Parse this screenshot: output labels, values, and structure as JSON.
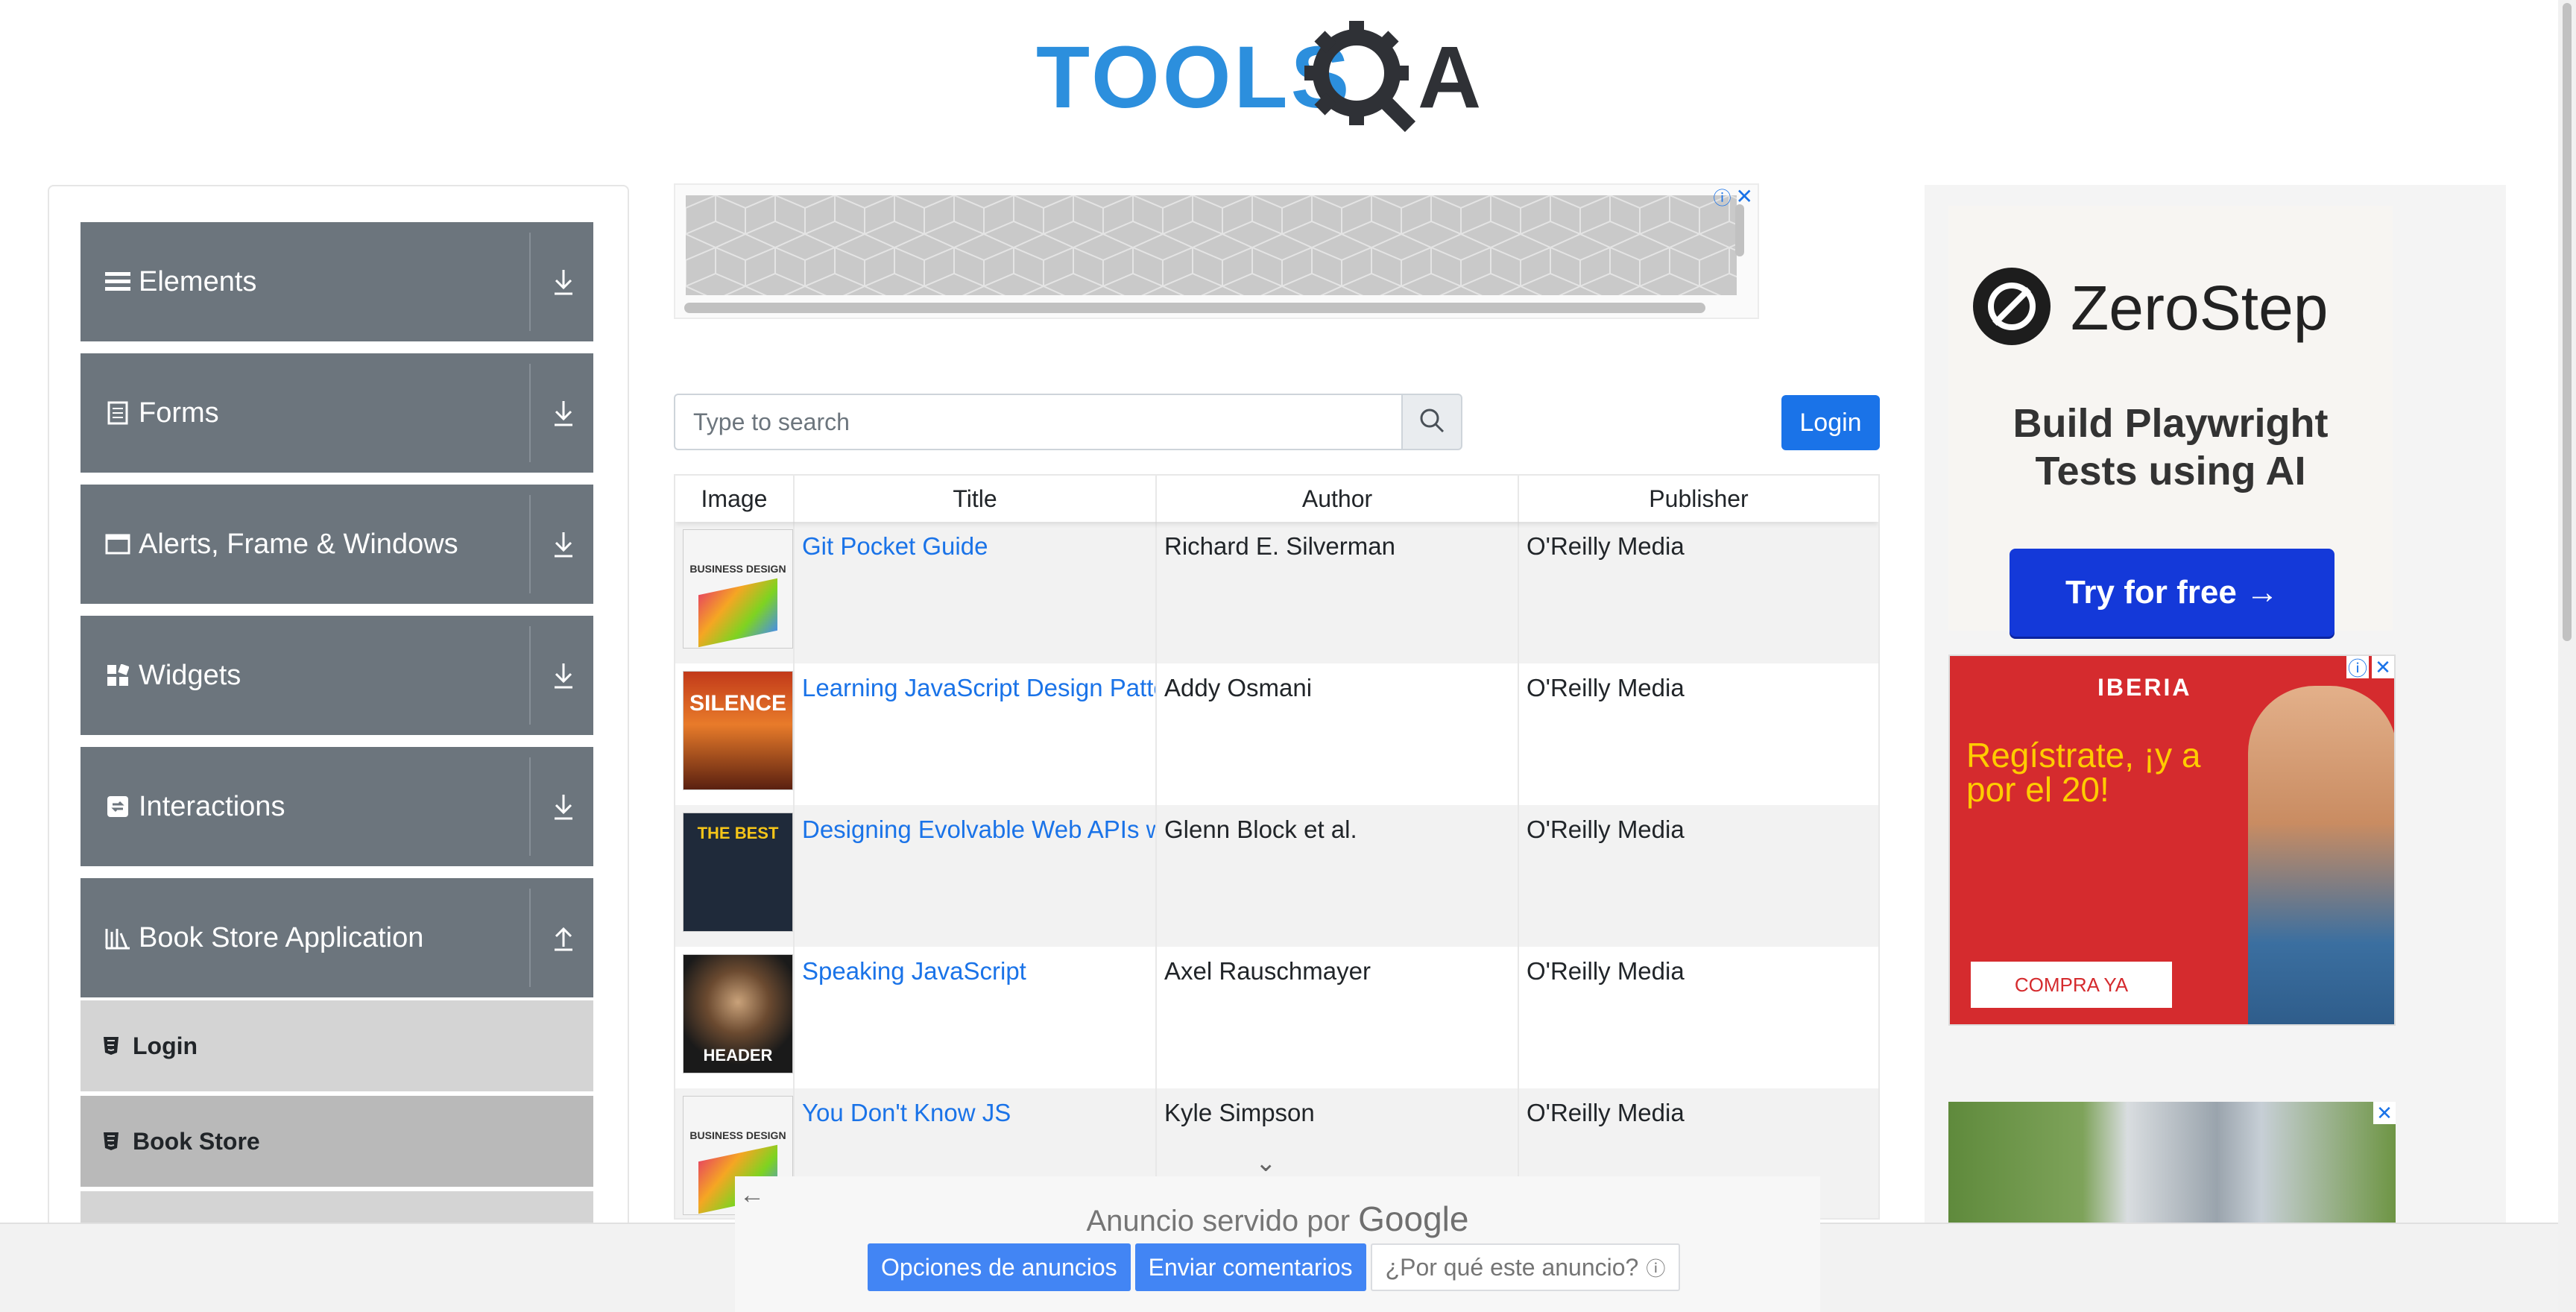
{
  "header": {
    "logo_text_tools": "TOOLS",
    "logo_text_qa": "QA"
  },
  "sidebar": {
    "groups": [
      {
        "label": "Elements",
        "icon": "hamburger-icon"
      },
      {
        "label": "Forms",
        "icon": "document-icon"
      },
      {
        "label": "Alerts, Frame & Windows",
        "icon": "window-icon"
      },
      {
        "label": "Widgets",
        "icon": "widgets-icon"
      },
      {
        "label": "Interactions",
        "icon": "interactions-icon"
      },
      {
        "label": "Book Store Application",
        "icon": "library-icon"
      }
    ],
    "subitems": [
      {
        "label": "Login",
        "icon": "html5-icon"
      },
      {
        "label": "Book Store",
        "icon": "html5-icon"
      }
    ]
  },
  "search": {
    "placeholder": "Type to search"
  },
  "login_button": "Login",
  "table": {
    "headers": [
      "Image",
      "Title",
      "Author",
      "Publisher"
    ],
    "rows": [
      {
        "title": "Git Pocket Guide",
        "author": "Richard E. Silverman",
        "publisher": "O'Reilly Media",
        "cover_text": "BUSINESS DESIGN"
      },
      {
        "title": "Learning JavaScript Design Patterns",
        "author": "Addy Osmani",
        "publisher": "O'Reilly Media",
        "cover_text": "SILENCE"
      },
      {
        "title": "Designing Evolvable Web APIs with ASP.NET",
        "author": "Glenn Block et al.",
        "publisher": "O'Reilly Media",
        "cover_text": "THE BEST"
      },
      {
        "title": "Speaking JavaScript",
        "author": "Axel Rauschmayer",
        "publisher": "O'Reilly Media",
        "cover_text": "HEADER"
      },
      {
        "title": "You Don't Know JS",
        "author": "Kyle Simpson",
        "publisher": "O'Reilly Media",
        "cover_text": "BUSINESS DESIGN"
      }
    ]
  },
  "ads": {
    "zerostep": {
      "brand": "ZeroStep",
      "tagline_line1": "Build Playwright",
      "tagline_line2": "Tests using AI",
      "cta": "Try for free →"
    },
    "iberia": {
      "logo": "IBERIA",
      "message": "Regístrate, ¡y a por el 20!",
      "cta": "COMPRA YA"
    },
    "google": {
      "served_prefix": "Anuncio servido por",
      "served_brand": "Google",
      "buttons": [
        "Opciones de anuncios",
        "Enviar comentarios",
        "¿Por qué este anuncio?"
      ]
    }
  },
  "colors": {
    "sidebar_group": "#6c757d",
    "link": "#1a73e8",
    "primary_button": "#1a73e8",
    "zerostep_button": "#1439d9",
    "iberia_red": "#d52b2e"
  }
}
